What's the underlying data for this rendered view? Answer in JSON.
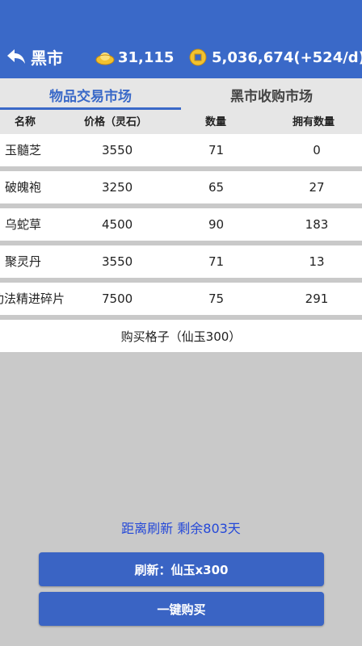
{
  "header": {
    "back_label": "黑市",
    "ingot_value": "31,115",
    "coin_value": "5,036,674(+524/d)"
  },
  "tabs": [
    {
      "label": "物品交易市场",
      "active": true
    },
    {
      "label": "黑市收购市场",
      "active": false
    }
  ],
  "columns": [
    "名称",
    "价格（灵石）",
    "数量",
    "拥有数量"
  ],
  "rows": [
    {
      "name": "玉髓芝",
      "price": "3550",
      "qty": "71",
      "own": "0"
    },
    {
      "name": "破魄袍",
      "price": "3250",
      "qty": "65",
      "own": "27"
    },
    {
      "name": "乌蛇草",
      "price": "4500",
      "qty": "90",
      "own": "183"
    },
    {
      "name": "聚灵丹",
      "price": "3550",
      "qty": "71",
      "own": "13"
    },
    {
      "name": "功法精进碎片",
      "price": "7500",
      "qty": "75",
      "own": "291"
    }
  ],
  "buy_slot_label": "购买格子（仙玉300）",
  "countdown_label": "距离刷新 剩余803天",
  "refresh_button_label": "刷新：仙玉x300",
  "buy_all_button_label": "一键购买",
  "colors": {
    "header_blue": "#3a69c8",
    "accent_blue": "#2448d8",
    "background_gray": "#c9c9c9"
  },
  "icons": {
    "back": "back-arrow-icon",
    "ingot": "gold-ingot-icon",
    "coin": "gold-coin-icon"
  }
}
